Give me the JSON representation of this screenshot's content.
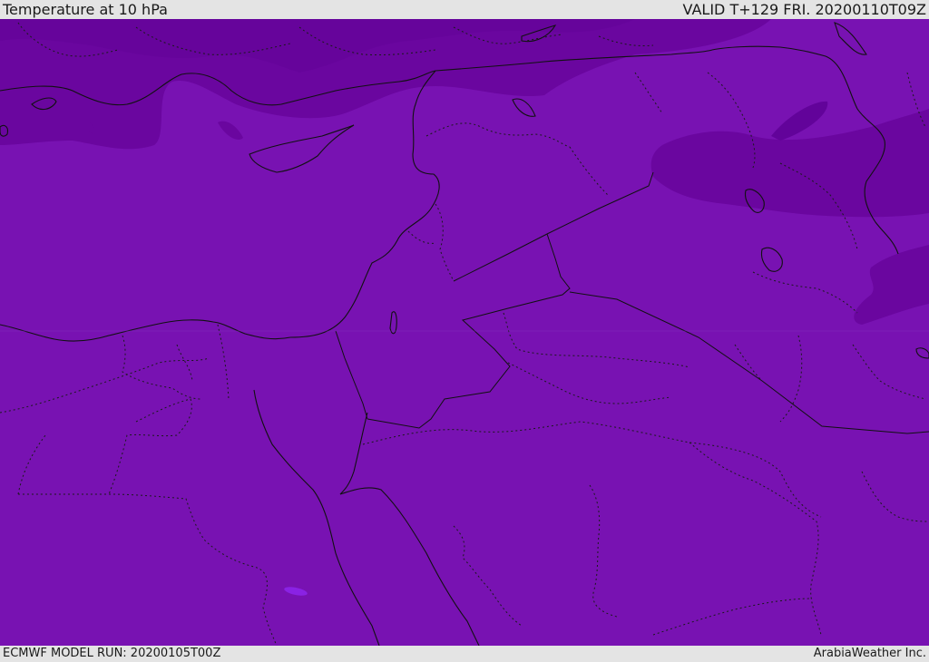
{
  "header": {
    "title": "Temperature at 10 hPa",
    "valid": "VALID T+129 FRI. 20200110T09Z"
  },
  "footer": {
    "model_run": "ECMWF MODEL RUN: 20200105T00Z",
    "credit": "ArabiaWeather Inc."
  },
  "colors": {
    "base_fill": "#7812b2",
    "cold_fill": "#6a069f",
    "warm_spot": "#8a22e4",
    "borders": "#111111",
    "bar_bg": "#e4e4e4"
  }
}
